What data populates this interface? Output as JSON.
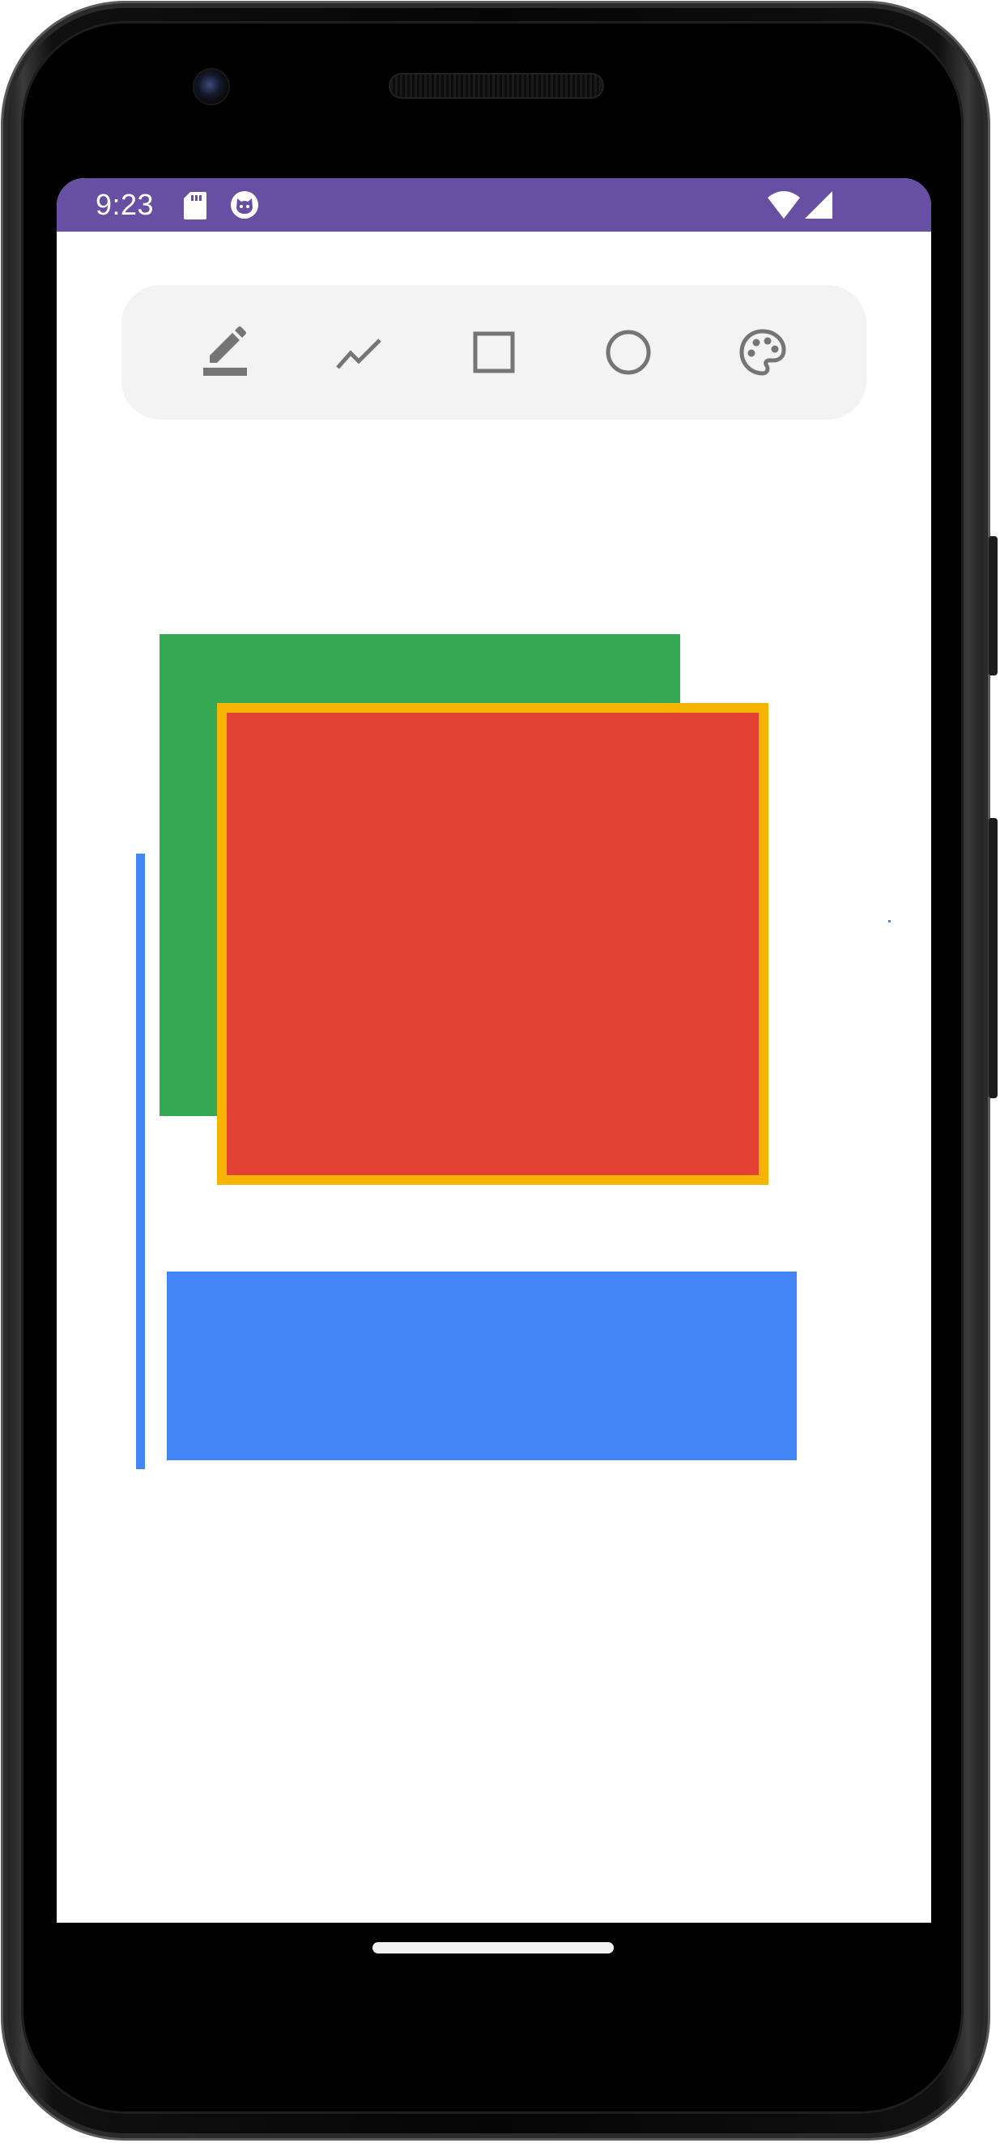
{
  "status_bar": {
    "time": "9:23",
    "background_color": "#6750a4",
    "left_icons": [
      "sd-card-icon",
      "cat-face-icon"
    ],
    "right_icons": [
      "wifi-icon",
      "cellular-signal-icon"
    ]
  },
  "toolbar": {
    "background_color": "#f3f3f3",
    "tools": [
      {
        "name": "pen",
        "icon": "pen-icon",
        "selected": true
      },
      {
        "name": "line",
        "icon": "polyline-icon",
        "selected": false
      },
      {
        "name": "rectangle",
        "icon": "rectangle-icon",
        "selected": false
      },
      {
        "name": "circle",
        "icon": "circle-icon",
        "selected": false
      },
      {
        "name": "color",
        "icon": "palette-icon",
        "selected": false
      }
    ],
    "icon_color": "#757575"
  },
  "canvas": {
    "shapes": [
      {
        "kind": "rectangle",
        "fill": "#34a853"
      },
      {
        "kind": "rectangle",
        "fill": "#e34133",
        "stroke": "#f4b400"
      },
      {
        "kind": "line",
        "stroke": "#4285f4"
      },
      {
        "kind": "rectangle",
        "fill": "#4285f4"
      },
      {
        "kind": "dot",
        "fill": "#4285f4"
      }
    ]
  }
}
